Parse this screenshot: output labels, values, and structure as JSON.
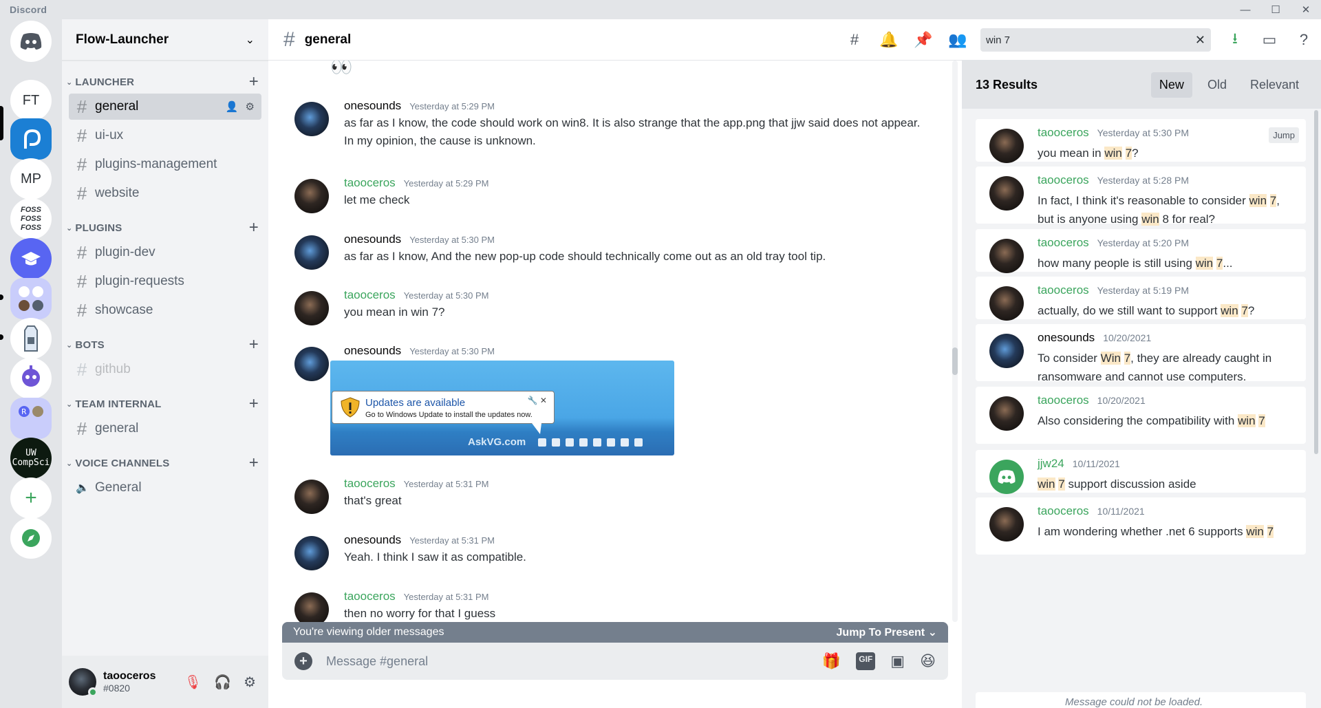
{
  "app": {
    "title": "Discord"
  },
  "window_controls": {
    "minimize": "—",
    "maximize": "☐",
    "close": "✕"
  },
  "servers": [
    {
      "name": "Direct Messages",
      "label": "",
      "icon": "discord-icon"
    },
    {
      "name": "FT",
      "label": "FT"
    },
    {
      "name": "Flow-Launcher",
      "label": "",
      "icon": "flow-launcher-icon"
    },
    {
      "name": "MP",
      "label": "MP"
    },
    {
      "name": "FOSS",
      "label": "FOSS\nFOSS\nFOSS"
    },
    {
      "name": "Education",
      "label": "",
      "icon": "graduation-cap-icon"
    },
    {
      "name": "Folder",
      "label": "",
      "icon": "server-folder-icon"
    },
    {
      "name": "Milk",
      "label": "",
      "icon": "milk-carton-icon"
    },
    {
      "name": "Robot",
      "label": "",
      "icon": "robot-icon"
    },
    {
      "name": "R",
      "label": "",
      "icon": "server-folder-icon"
    },
    {
      "name": "UW CompSci",
      "label": "UW\nCompSci"
    }
  ],
  "server": {
    "name": "Flow-Launcher",
    "categories": [
      {
        "name": "LAUNCHER",
        "channels": [
          {
            "name": "general",
            "selected": true
          },
          {
            "name": "ui-ux"
          },
          {
            "name": "plugins-management"
          },
          {
            "name": "website"
          }
        ]
      },
      {
        "name": "PLUGINS",
        "channels": [
          {
            "name": "plugin-dev"
          },
          {
            "name": "plugin-requests"
          },
          {
            "name": "showcase"
          }
        ]
      },
      {
        "name": "BOTS",
        "channels": [
          {
            "name": "github",
            "muted": true
          }
        ]
      },
      {
        "name": "TEAM INTERNAL",
        "channels": [
          {
            "name": "general"
          }
        ]
      },
      {
        "name": "VOICE CHANNELS",
        "channels": [
          {
            "name": "General",
            "voice": true
          }
        ]
      }
    ]
  },
  "user": {
    "name": "taooceros",
    "tag": "#0820"
  },
  "channel_header": {
    "title": "general"
  },
  "search": {
    "value": "win 7"
  },
  "messages": [
    {
      "author": "onesounds",
      "time": "Yesterday at 5:29 PM",
      "text": "as far as I know, the code should work on win8. It is also strange that the app.png that jjw said does not appear. In my opinion, the cause is unknown."
    },
    {
      "author": "taooceros",
      "time": "Yesterday at 5:29 PM",
      "text": "let me check"
    },
    {
      "author": "onesounds",
      "time": "Yesterday at 5:30 PM",
      "text": "as far as I know, And the new pop-up code should technically come out as an old tray tool tip."
    },
    {
      "author": "taooceros",
      "time": "Yesterday at 5:30 PM",
      "text": "you mean in win 7?"
    },
    {
      "author": "onesounds",
      "time": "Yesterday at 5:30 PM",
      "text": ""
    },
    {
      "author": "taooceros",
      "time": "Yesterday at 5:31 PM",
      "text": "that's great"
    },
    {
      "author": "onesounds",
      "time": "Yesterday at 5:31 PM",
      "text": "Yeah. I think I saw it as compatible."
    },
    {
      "author": "taooceros",
      "time": "Yesterday at 5:31 PM",
      "text": "then no worry for that I guess"
    }
  ],
  "embed": {
    "balloon_title": "Updates are available",
    "balloon_text": "Go to Windows Update to install the updates now.",
    "watermark": "AskVG.com"
  },
  "older_bar": {
    "text": "You're viewing older messages",
    "jump": "Jump To Present"
  },
  "composer": {
    "placeholder": "Message #general",
    "gif": "GIF"
  },
  "results": {
    "count": "13 Results",
    "sort": [
      "New",
      "Old",
      "Relevant"
    ],
    "channel": "general",
    "jump_label": "Jump",
    "items": [
      {
        "author": "taooceros",
        "time": "Yesterday at 5:30 PM",
        "parts": [
          [
            "you mean in ",
            0
          ],
          [
            "win",
            1
          ],
          [
            " ",
            0
          ],
          [
            "7",
            1
          ],
          [
            "?",
            0
          ]
        ]
      },
      {
        "author": "taooceros",
        "time": "Yesterday at 5:28 PM",
        "parts": [
          [
            "In fact, I think it's reasonable to consider ",
            0
          ],
          [
            "win",
            1
          ],
          [
            " ",
            0
          ],
          [
            "7",
            1
          ],
          [
            ", but is anyone using ",
            0
          ],
          [
            "win",
            1
          ],
          [
            " 8 for real?",
            0
          ]
        ]
      },
      {
        "author": "taooceros",
        "time": "Yesterday at 5:20 PM",
        "parts": [
          [
            "how many people is still using ",
            0
          ],
          [
            "win",
            1
          ],
          [
            " ",
            0
          ],
          [
            "7",
            1
          ],
          [
            "...",
            0
          ]
        ]
      },
      {
        "author": "taooceros",
        "time": "Yesterday at 5:19 PM",
        "parts": [
          [
            "actually, do we still want to support ",
            0
          ],
          [
            "win",
            1
          ],
          [
            " ",
            0
          ],
          [
            "7",
            1
          ],
          [
            "?",
            0
          ]
        ]
      },
      {
        "author": "onesounds",
        "time": "10/20/2021",
        "parts": [
          [
            "To consider ",
            0
          ],
          [
            "Win",
            1
          ],
          [
            " ",
            0
          ],
          [
            "7",
            1
          ],
          [
            ", they are already caught in ransomware and cannot use computers.",
            0
          ]
        ]
      },
      {
        "author": "taooceros",
        "time": "10/20/2021",
        "parts": [
          [
            "Also considering the compatibility with ",
            0
          ],
          [
            "win",
            1
          ],
          [
            " ",
            0
          ],
          [
            "7",
            1
          ]
        ]
      },
      {
        "author": "jjw24",
        "time": "10/11/2021",
        "parts": [
          [
            "win",
            1
          ],
          [
            " ",
            0
          ],
          [
            "7",
            1
          ],
          [
            " support discussion aside",
            0
          ]
        ]
      },
      {
        "author": "taooceros",
        "time": "10/11/2021",
        "parts": [
          [
            "I am wondering whether .net 6 supports ",
            0
          ],
          [
            "win",
            1
          ],
          [
            " ",
            0
          ],
          [
            "7",
            1
          ]
        ]
      }
    ],
    "bottom_notice": "Message could not be loaded."
  }
}
